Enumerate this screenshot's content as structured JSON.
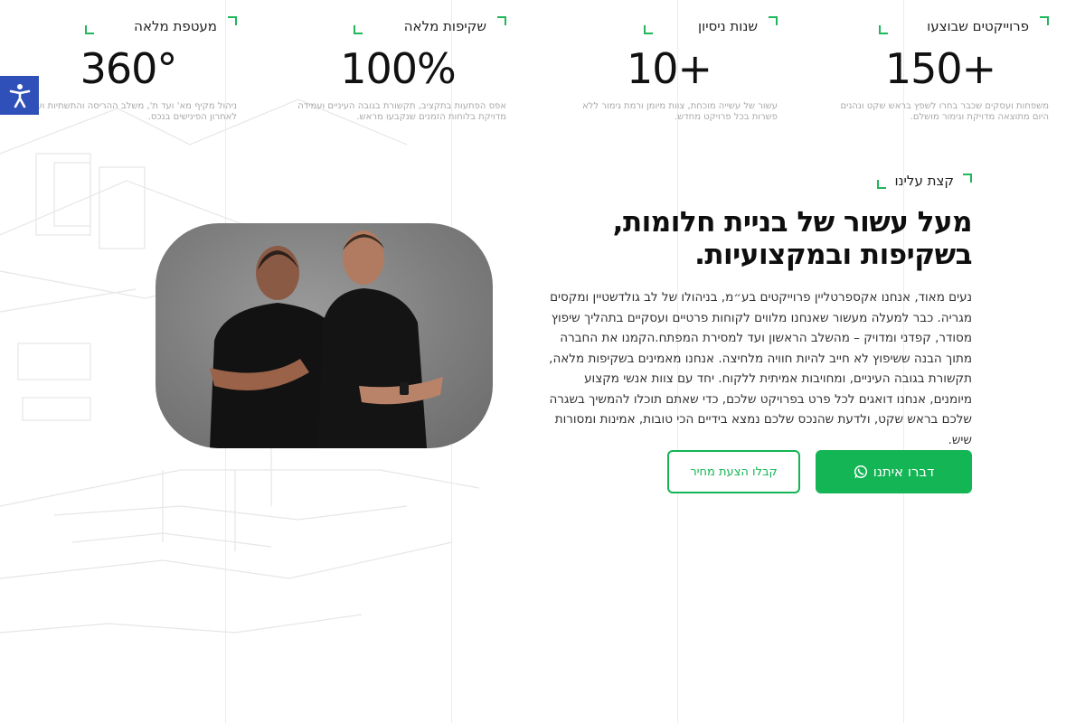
{
  "stats": [
    {
      "label": "פרוייקטים שבוצעו",
      "value": "150+",
      "desc": "משפחות ועסקים שכבר בחרו לשפץ בראש שקט ונהנים היום מתוצאה מדויקת וגימור מושלם."
    },
    {
      "label": "שנות ניסיון",
      "value": "10+",
      "desc": "עשור של עשייה מוכחת, צוות מיומן ורמת גימור ללא פשרות בכל פרויקט מחדש."
    },
    {
      "label": "שקיפות מלאה",
      "value": "100%",
      "desc": "אפס הפתעות בתקציב, תקשורת בגובה העיניים ועמידה מדויקת בלוחות הזמנים שנקבעו מראש."
    },
    {
      "label": "מעטפת מלאה",
      "value": "360°",
      "desc": "ניהול מקיף מא' ועד ת', משלב ההריסה והתשתיות ועד לאחרון הפינישים בנכס."
    }
  ],
  "about": {
    "eyebrow": "קצת עלינו",
    "headline": "מעל עשור של בניית חלומות, בשקיפות ובמקצועיות.",
    "body": "נעים מאוד, אנחנו אקספרטליין פרוייקטים בע״מ, בניהולו של לב גולדשטיין ומקסים מגריה. כבר למעלה מעשור שאנחנו מלווים לקוחות פרטיים ועסקיים בתהליך שיפוץ מסודר, קפדני ומדויק – מהשלב הראשון ועד למסירת המפתח.הקמנו את החברה מתוך הבנה ששיפוץ לא חייב להיות חוויה מלחיצה. אנחנו מאמינים בשקיפות מלאה, תקשורת בגובה העיניים, ומחויבות אמיתית ללקוח. יחד עם צוות אנשי מקצוע מיומנים, אנחנו דואגים לכל פרט בפרויקט שלכם, כדי שאתם תוכלו להמשיך בשגרה שלכם בראש שקט, ולדעת שהנכס שלכם נמצא בידיים הכי טובות, אמינות ומסורות שיש."
  },
  "cta": {
    "primary_label": "דברו איתנו",
    "secondary_label": "קבלו הצעת מחיר"
  },
  "icons": {
    "primary_icon": "whatsapp-icon",
    "a11y_icon": "accessibility-icon"
  },
  "colors": {
    "accent": "#13b554",
    "a11y": "#2f50b8"
  }
}
